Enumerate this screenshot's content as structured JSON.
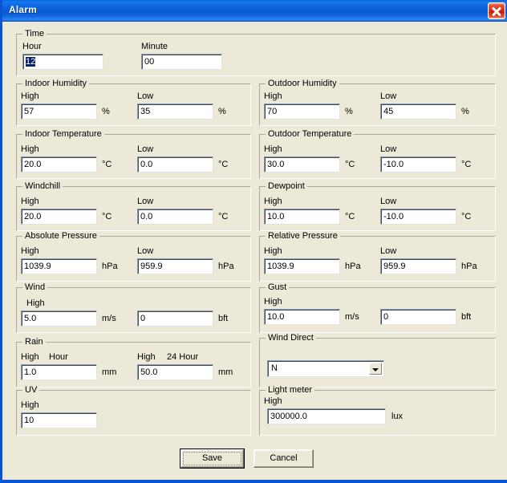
{
  "window": {
    "title": "Alarm",
    "close_icon": "close-icon"
  },
  "groups": {
    "time": {
      "legend": "Time",
      "hour_label": "Hour",
      "hour_value": "12",
      "minute_label": "Minute",
      "minute_value": "00"
    },
    "indoor_humidity": {
      "legend": "Indoor Humidity",
      "high_label": "High",
      "high_value": "57",
      "high_unit": "%",
      "low_label": "Low",
      "low_value": "35",
      "low_unit": "%"
    },
    "outdoor_humidity": {
      "legend": "Outdoor Humidity",
      "high_label": "High",
      "high_value": "70",
      "high_unit": "%",
      "low_label": "Low",
      "low_value": "45",
      "low_unit": "%"
    },
    "indoor_temperature": {
      "legend": "Indoor Temperature",
      "high_label": "High",
      "high_value": "20.0",
      "high_unit": "°C",
      "low_label": "Low",
      "low_value": "0.0",
      "low_unit": "°C"
    },
    "outdoor_temperature": {
      "legend": "Outdoor Temperature",
      "high_label": "High",
      "high_value": "30.0",
      "high_unit": "°C",
      "low_label": "Low",
      "low_value": "-10.0",
      "low_unit": "°C"
    },
    "windchill": {
      "legend": "Windchill",
      "high_label": "High",
      "high_value": "20.0",
      "high_unit": "°C",
      "low_label": "Low",
      "low_value": "0.0",
      "low_unit": "°C"
    },
    "dewpoint": {
      "legend": "Dewpoint",
      "high_label": "High",
      "high_value": "10.0",
      "high_unit": "°C",
      "low_label": "Low",
      "low_value": "-10.0",
      "low_unit": "°C"
    },
    "absolute_pressure": {
      "legend": "Absolute Pressure",
      "high_label": "High",
      "high_value": "1039.9",
      "high_unit": "hPa",
      "low_label": "Low",
      "low_value": "959.9",
      "low_unit": "hPa"
    },
    "relative_pressure": {
      "legend": "Relative Pressure",
      "high_label": "High",
      "high_value": "1039.9",
      "high_unit": "hPa",
      "low_label": "Low",
      "low_value": "959.9",
      "low_unit": "hPa"
    },
    "wind": {
      "legend": "Wind",
      "high_label": "High",
      "ms_value": "5.0",
      "ms_unit": "m/s",
      "bft_value": "0",
      "bft_unit": "bft"
    },
    "gust": {
      "legend": "Gust",
      "high_label": "High",
      "ms_value": "10.0",
      "ms_unit": "m/s",
      "bft_value": "0",
      "bft_unit": "bft"
    },
    "rain": {
      "legend": "Rain",
      "hour_high_label": "High",
      "hour_label": "Hour",
      "hour_value": "1.0",
      "hour_unit": "mm",
      "day_high_label": "High",
      "day_label": "24 Hour",
      "day_value": "50.0",
      "day_unit": "mm"
    },
    "wind_direct": {
      "legend": "Wind Direct",
      "value": "N",
      "arrow_icon": "chevron-down-icon"
    },
    "uv": {
      "legend": "UV",
      "high_label": "High",
      "high_value": "10"
    },
    "light_meter": {
      "legend": "Light meter",
      "high_label": "High",
      "high_value": "300000.0",
      "high_unit": "lux"
    }
  },
  "buttons": {
    "save": "Save",
    "cancel": "Cancel"
  }
}
